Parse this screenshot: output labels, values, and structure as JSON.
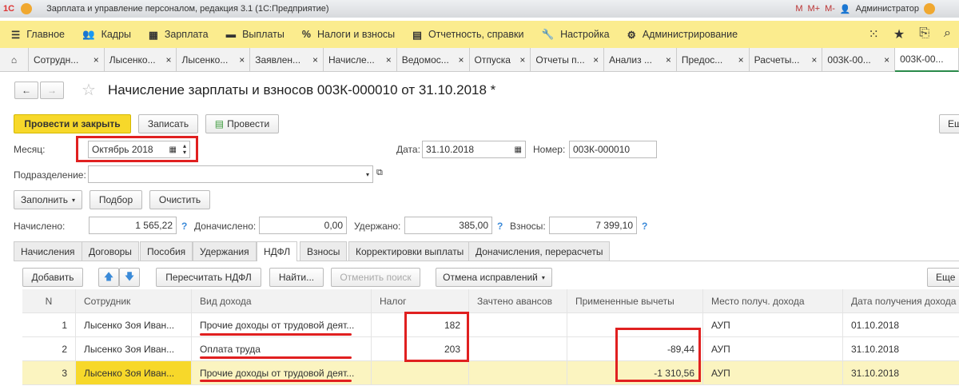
{
  "window": {
    "title": "Зарплата и управление персоналом, редакция 3.1  (1С:Предприятие)",
    "user": "Администратор",
    "mem_buttons": [
      "M",
      "M+",
      "M-"
    ]
  },
  "menu": [
    {
      "icon": "☰",
      "label": "Главное"
    },
    {
      "icon": "👥",
      "label": "Кадры"
    },
    {
      "icon": "▦",
      "label": "Зарплата"
    },
    {
      "icon": "▬",
      "label": "Выплаты"
    },
    {
      "icon": "%",
      "label": "Налоги и взносы"
    },
    {
      "icon": "▤",
      "label": "Отчетность, справки"
    },
    {
      "icon": "🔧",
      "label": "Настройка"
    },
    {
      "icon": "⚙",
      "label": "Администрирование"
    }
  ],
  "open_tabs": [
    "Сотрудн...",
    "Лысенко...",
    "Лысенко...",
    "Заявлен...",
    "Начисле...",
    "Ведомос...",
    "Отпуска",
    "Отчеты п...",
    "Анализ ...",
    "Предос...",
    "Расчеты...",
    "003К-00...",
    "003К-00..."
  ],
  "doc": {
    "title": "Начисление зарплаты и взносов 003К-000010 от 31.10.2018 *",
    "buttons": {
      "post_close": "Провести и закрыть",
      "save": "Записать",
      "post": "Провести",
      "more": "Еще"
    },
    "month_label": "Месяц:",
    "month": "Октябрь 2018",
    "date_label": "Дата:",
    "date": "31.10.2018",
    "number_label": "Номер:",
    "number": "003К-000010",
    "dept_label": "Подразделение:",
    "dept": "",
    "fill": "Заполнить",
    "select": "Подбор",
    "clear": "Очистить",
    "accrued_label": "Начислено:",
    "accrued": "1 565,22",
    "extra_label": "Доначислено:",
    "extra": "0,00",
    "withheld_label": "Удержано:",
    "withheld": "385,00",
    "contrib_label": "Взносы:",
    "contrib": "7 399,10",
    "help": "?"
  },
  "tabs": [
    "Начисления",
    "Договоры",
    "Пособия",
    "Удержания",
    "НДФЛ",
    "Взносы",
    "Корректировки выплаты",
    "Доначисления, перерасчеты"
  ],
  "toolbar": {
    "add": "Добавить",
    "recalc": "Пересчитать НДФЛ",
    "find": "Найти...",
    "cancel_search": "Отменить поиск",
    "cancel_fix": "Отмена исправлений",
    "more": "Еще"
  },
  "table": {
    "columns": [
      "N",
      "Сотрудник",
      "Вид дохода",
      "Налог",
      "Зачтено авансов",
      "Примененные вычеты",
      "Место получ. дохода",
      "Дата получения дохода"
    ],
    "rows": [
      [
        "1",
        "Лысенко Зоя Иван...",
        "Прочие доходы от трудовой деят...",
        "182",
        "",
        "",
        "АУП",
        "01.10.2018"
      ],
      [
        "2",
        "Лысенко Зоя Иван...",
        "Оплата труда",
        "203",
        "",
        "-89,44",
        "АУП",
        "31.10.2018"
      ],
      [
        "3",
        "Лысенко Зоя Иван...",
        "Прочие доходы от трудовой деят...",
        "",
        "",
        "-1 310,56",
        "АУП",
        "31.10.2018"
      ]
    ]
  }
}
